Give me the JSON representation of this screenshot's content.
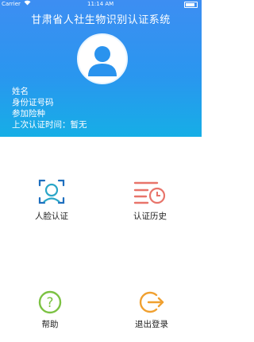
{
  "status_bar": {
    "carrier": "Carrier",
    "time": "11:14 AM"
  },
  "header": {
    "title": "甘肃省人社生物识别认证系统"
  },
  "user_info": {
    "name": "姓名",
    "id_number": "身份证号码",
    "insurance": "参加险种",
    "last_auth": "上次认证时间：暂无"
  },
  "menu": {
    "face_auth": {
      "label": "人脸认证",
      "icon": "face-scan-icon",
      "color": "#1e6fbf"
    },
    "auth_history": {
      "label": "认证历史",
      "icon": "history-clock-icon",
      "color": "#e8746a"
    },
    "help": {
      "label": "帮助",
      "icon": "help-question-icon",
      "color": "#7cc243"
    },
    "logout": {
      "label": "退出登录",
      "icon": "logout-arrow-icon",
      "color": "#f0a030"
    }
  },
  "colors": {
    "header_top": "#3d8ef2",
    "header_bottom": "#16aee6"
  }
}
